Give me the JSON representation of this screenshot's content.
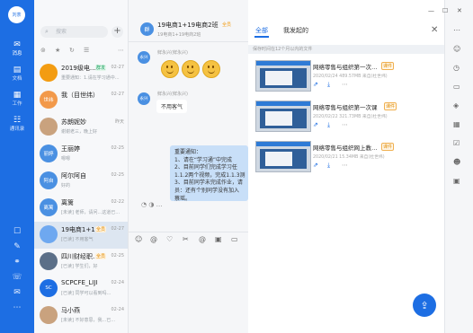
{
  "rail": {
    "avatar": "刘茶",
    "nav": [
      {
        "icon": "chat-icon",
        "label": "消息"
      },
      {
        "icon": "document-icon",
        "label": "文档"
      },
      {
        "icon": "work-icon",
        "label": "工作"
      },
      {
        "icon": "contacts-icon",
        "label": "通讯录"
      }
    ]
  },
  "conv": {
    "search_placeholder": "搜索",
    "items": [
      {
        "name": "2019级电…",
        "tag": "群发",
        "time": "02-27",
        "preview": "重要通知：1.请在学习通中...",
        "avatar": "",
        "color": "#f39c12",
        "selected": false
      },
      {
        "name": "我（目世纬）",
        "tag": "",
        "time": "02-27",
        "preview": "",
        "avatar": "世纬",
        "color": "#f2994a",
        "selected": false
      },
      {
        "name": "苏朗妮妙",
        "tag": "",
        "time": "昨天",
        "preview": "谢谢老三，晚上好",
        "avatar": "",
        "color": "#c9a27e",
        "selected": false
      },
      {
        "name": "王丽婷",
        "tag": "",
        "time": "02-25",
        "preview": "嗯嗯",
        "avatar": "丽婷",
        "color": "#4a90e2",
        "selected": false
      },
      {
        "name": "阿尔阿自",
        "tag": "",
        "time": "02-25",
        "preview": "好的",
        "avatar": "阿自",
        "color": "#4a90e2",
        "selected": false
      },
      {
        "name": "离篱",
        "tag": "",
        "time": "02-22",
        "preview": "[未读] 老师，请问...这道已…",
        "avatar": "离篱",
        "color": "#4a90e2",
        "selected": false
      },
      {
        "name": "19电商1+1…",
        "tag": "全员",
        "time": "02-27",
        "preview": "[已读] 不用客气",
        "avatar": "",
        "color": "#6ea8f0",
        "selected": true
      },
      {
        "name": "四川财经职…",
        "tag": "全员",
        "time": "02-25",
        "preview": "[已读] 学生们，好",
        "avatar": "",
        "color": "#5b6f88",
        "selected": false
      },
      {
        "name": "SCPCFE_LIJI",
        "tag": "",
        "time": "02-24",
        "preview": "[已读] 同学可以看到吗…",
        "avatar": "SC",
        "color": "#1d6ee3",
        "selected": false
      },
      {
        "name": "马小燕",
        "tag": "",
        "time": "02-24",
        "preview": "[未读] 不好意思，我...已…",
        "avatar": "",
        "color": "#c9a27e",
        "selected": false
      }
    ]
  },
  "chat": {
    "title": "19电商1+19电商2班",
    "title_tag": "全员",
    "subtitle": "19电商1+19电商2班",
    "messages": [
      {
        "sender": "鲜永兴(鲜永兴)",
        "avatar": "永兴"
      },
      {
        "sender": "鲜永兴(鲜永兴)",
        "avatar": "永兴",
        "text": "不用客气"
      }
    ],
    "notice_lines": [
      "重要通知：",
      "1、请在“学习通”中完成",
      "2、目前同学们完成学习任",
      "1.1.2两个视频，完成1.1.3测",
      "3、目前同学未完成作业，请",
      "员：还有个别同学没有加入",
      "蔡瑶。"
    ]
  },
  "right": {
    "tabs": [
      "全部",
      "我发起的"
    ],
    "notice": "保存时间在12个月以内的文件",
    "files": [
      {
        "title": "网络零售与组织第一次…",
        "tag": "课件",
        "meta": "2020/02/24 489.57MB 来自(杜世纬)"
      },
      {
        "title": "网络零售与组织第一次课",
        "tag": "课件",
        "meta": "2020/02/22 321.73MB 来自(杜世纬)"
      },
      {
        "title": "网络零售与组织网上教…",
        "tag": "课件",
        "meta": "2020/02/21 15.34MB 来自(杜世纬)"
      }
    ]
  },
  "colors": {
    "primary": "#1d6ee3",
    "tag_orange": "#e08a00"
  }
}
